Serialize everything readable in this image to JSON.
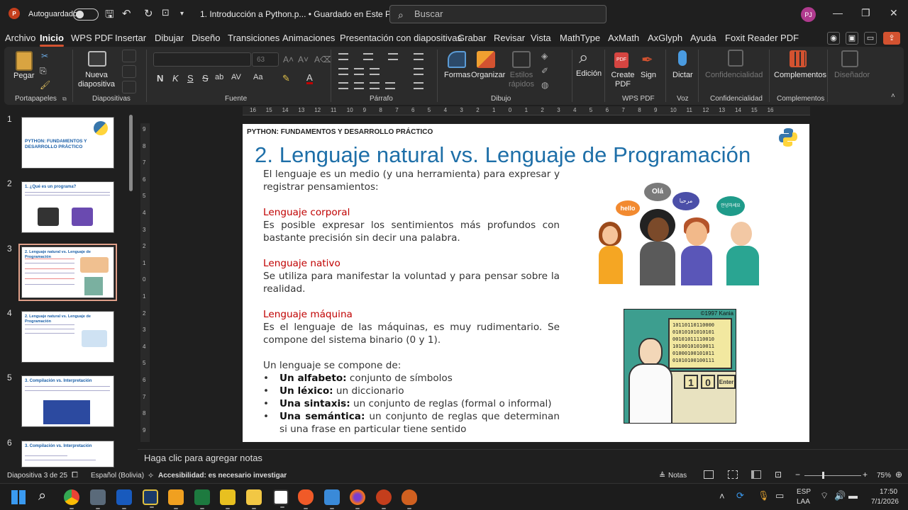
{
  "titlebar": {
    "logo": "P",
    "autosave_label": "Autoguardado",
    "doc_title": "1. Introducción a Python.p...  •  Guardado en Este PC",
    "search_placeholder": "Buscar",
    "avatar_initials": "PJ"
  },
  "menu": [
    "Archivo",
    "Inicio",
    "WPS PDF",
    "Insertar",
    "Dibujar",
    "Diseño",
    "Transiciones",
    "Animaciones",
    "Presentación con diapositivas",
    "Grabar",
    "Revisar",
    "Vista",
    "MathType",
    "AxMath",
    "AxGlyph",
    "Ayuda",
    "Foxit Reader PDF"
  ],
  "ribbon": {
    "paste": "Pegar",
    "new_slide": "Nueva diapositiva",
    "font_size": "63",
    "shapes": "Formas",
    "arrange": "Organizar",
    "quick_styles": "Estilos rápidos",
    "editing": "Edición",
    "create_pdf": "Create PDF",
    "sign": "Sign",
    "dictate": "Dictar",
    "confidentiality": "Confidencialidad",
    "addins": "Complementos",
    "designer": "Diseñador",
    "groups": {
      "clipboard": "Portapapeles",
      "slides": "Diapositivas",
      "font": "Fuente",
      "paragraph": "Párrafo",
      "drawing": "Dibujo",
      "wps_pdf": "WPS PDF",
      "voice": "Voz",
      "confidentiality": "Confidencialidad",
      "addins": "Complementos"
    }
  },
  "thumbnails": [
    {
      "num": "1",
      "title": "PYTHON: FUNDAMENTOS Y DESARROLLO PRÁCTICO"
    },
    {
      "num": "2",
      "title": "1. ¿Qué es un programa?"
    },
    {
      "num": "3",
      "title": "2. Lenguaje natural vs. Lenguaje de Programación"
    },
    {
      "num": "4",
      "title": "2. Lenguaje natural vs. Lenguaje de Programación"
    },
    {
      "num": "5",
      "title": "3. Compilación vs. Interpretación"
    },
    {
      "num": "6",
      "title": "3. Compilación vs. Interpretación"
    }
  ],
  "slide": {
    "header": "PYTHON: FUNDAMENTOS Y DESARROLLO PRÁCTICO",
    "title": "2. Lenguaje natural vs. Lenguaje de Programación",
    "intro": "El lenguaje es un medio (y una herramienta) para expresar y registrar pensamientos:",
    "h1": "Lenguaje corporal",
    "p1": "Es posible expresar los sentimientos más profundos con bastante precisión sin decir una palabra.",
    "h2": "Lenguaje nativo",
    "p2": "Se utiliza para manifestar la voluntad y para pensar sobre la realidad.",
    "h3": "Lenguaje máquina",
    "p3": "Es el lenguaje de las máquinas, es muy rudimentario. Se compone del sistema binario (0 y 1).",
    "compose": "Un lenguaje se compone de:",
    "bullets": [
      {
        "term": "Un alfabeto:",
        "desc": " conjunto de símbolos"
      },
      {
        "term": "Un léxico:",
        "desc": " un diccionario"
      },
      {
        "term": "Una sintaxis:",
        "desc": " un conjunto de reglas (formal o informal)"
      },
      {
        "term": "Una semántica:",
        "desc": " un conjunto de reglas que determinan si una frase en particular tiene sentido"
      }
    ],
    "bubbles": [
      "hello",
      "Olá",
      "مرحبا",
      "안녕하세요"
    ],
    "cartoon_copyright": "©1997 Kania",
    "cartoon_keys": [
      "1",
      "0",
      "Enter"
    ],
    "binary_lines": [
      "10110110110000",
      "01010101010101",
      "00101011110010",
      "10100101010011",
      "01000100101011",
      "01010100100111"
    ]
  },
  "notes_placeholder": "Haga clic para agregar notas",
  "status": {
    "slide_count": "Diapositiva 3 de 25",
    "language": "Español (Bolivia)",
    "accessibility": "Accesibilidad: es necesario investigar",
    "notes": "Notas",
    "zoom": "75%"
  },
  "taskbar": {
    "lang_top": "ESP",
    "lang_bottom": "LAA",
    "time": "17:50",
    "date": "7/1/2026"
  }
}
